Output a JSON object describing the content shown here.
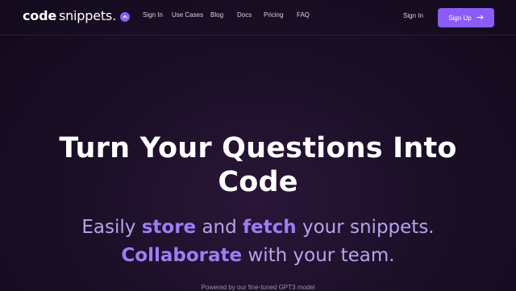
{
  "nav": {
    "logo_bold": "code",
    "logo_light": "snippets.",
    "logo_badge_icon": "chevron-up-icon",
    "links": [
      "Sign In",
      "Use Cases",
      "Blog",
      "Docs",
      "Pricing",
      "FAQ"
    ],
    "signin_label": "Sign In",
    "signup_label": "Sign Up",
    "signup_icon": "arrow-right-icon"
  },
  "hero": {
    "title_line1": "Turn Your Questions Into",
    "title_line2": "Code",
    "sub_pre": "Easily",
    "sub_store": "store",
    "sub_and": "and",
    "sub_fetch": "fetch",
    "sub_post": "your snippets.",
    "sub_collab": "Collaborate",
    "sub_team": "with your team.",
    "powered": "Powered by our fine-tuned GPT3 model"
  },
  "colors": {
    "accent": "#8b5cf6",
    "background": "#1c0f28",
    "subtitle": "#b7a4ec"
  }
}
